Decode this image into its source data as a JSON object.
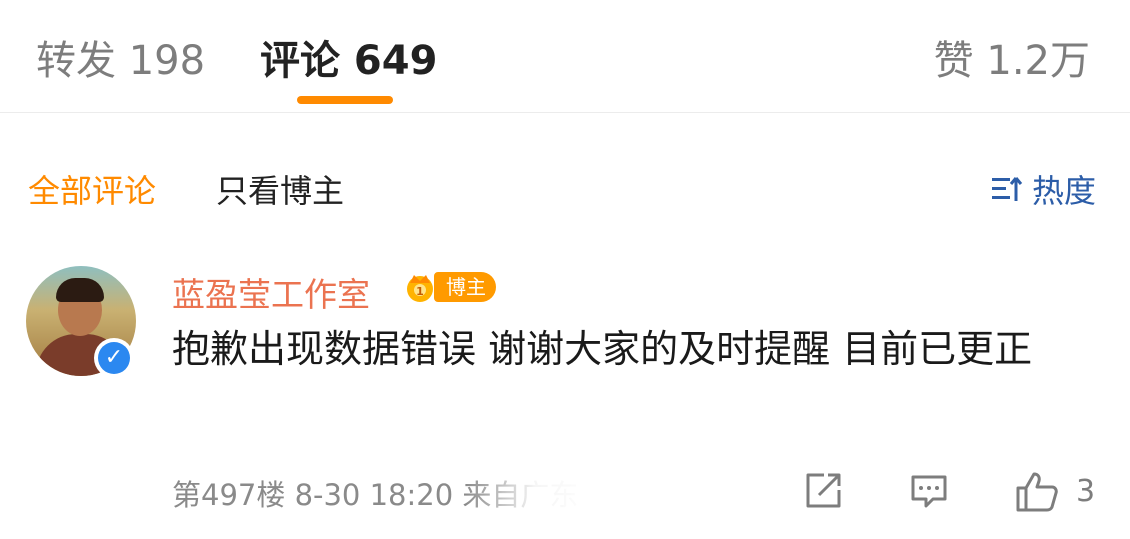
{
  "tabs": {
    "repost": "转发 198",
    "comments": "评论 649",
    "likes": "赞 1.2万"
  },
  "filters": {
    "all_comments": "全部评论",
    "author_only": "只看博主"
  },
  "sort": {
    "label": "热度",
    "icon": "sort-icon"
  },
  "comment": {
    "username": "蓝盈莹工作室",
    "badge_label": "博主",
    "content": "抱歉出现数据错误 谢谢大家的及时提醒 目前已更正",
    "meta": "第497楼 8-30 18:20 来自广东",
    "like_count": "3"
  },
  "colors": {
    "accent": "#ff8a00",
    "username": "#eb7350",
    "sort_blue": "#2c5da8",
    "verified_blue": "#2b88f0"
  },
  "icons": [
    "share-icon",
    "reply-icon",
    "like-icon",
    "crown-icon",
    "verified-icon"
  ]
}
